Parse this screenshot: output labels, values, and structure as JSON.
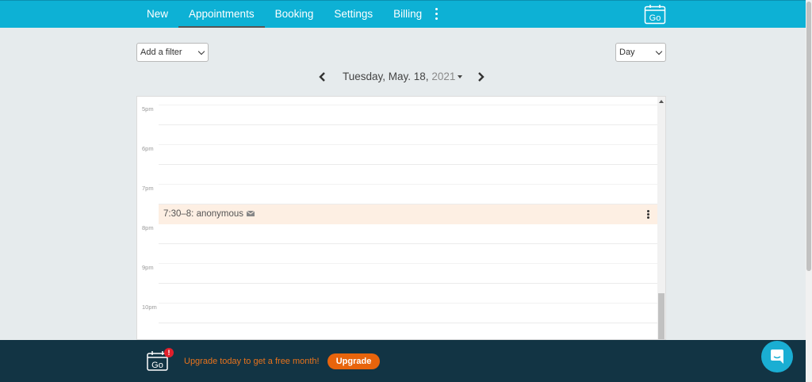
{
  "nav": {
    "items": [
      {
        "label": "New",
        "active": false
      },
      {
        "label": "Appointments",
        "active": true
      },
      {
        "label": "Booking",
        "active": false
      },
      {
        "label": "Settings",
        "active": false
      },
      {
        "label": "Billing",
        "active": false
      }
    ],
    "more_icon": "vertical-dots-icon",
    "logo_text": "Go"
  },
  "filter": {
    "value": "Add a filter"
  },
  "view": {
    "value": "Day"
  },
  "date": {
    "weekday_day": "Tuesday, May. 18,",
    "year": "2021"
  },
  "calendar": {
    "hours": [
      "5pm",
      "6pm",
      "7pm",
      "8pm",
      "9pm",
      "10pm"
    ],
    "appointment": {
      "text": "7:30–8: anonymous",
      "icon": "envelope-icon",
      "color": "#fdefe3"
    }
  },
  "banner": {
    "logo_text": "Go",
    "badge": "!",
    "message": "Upgrade today to get a free month!",
    "button": "Upgrade"
  },
  "colors": {
    "accent": "#0db1d5",
    "banner_bg": "#123444",
    "upgrade": "#e8640c"
  }
}
